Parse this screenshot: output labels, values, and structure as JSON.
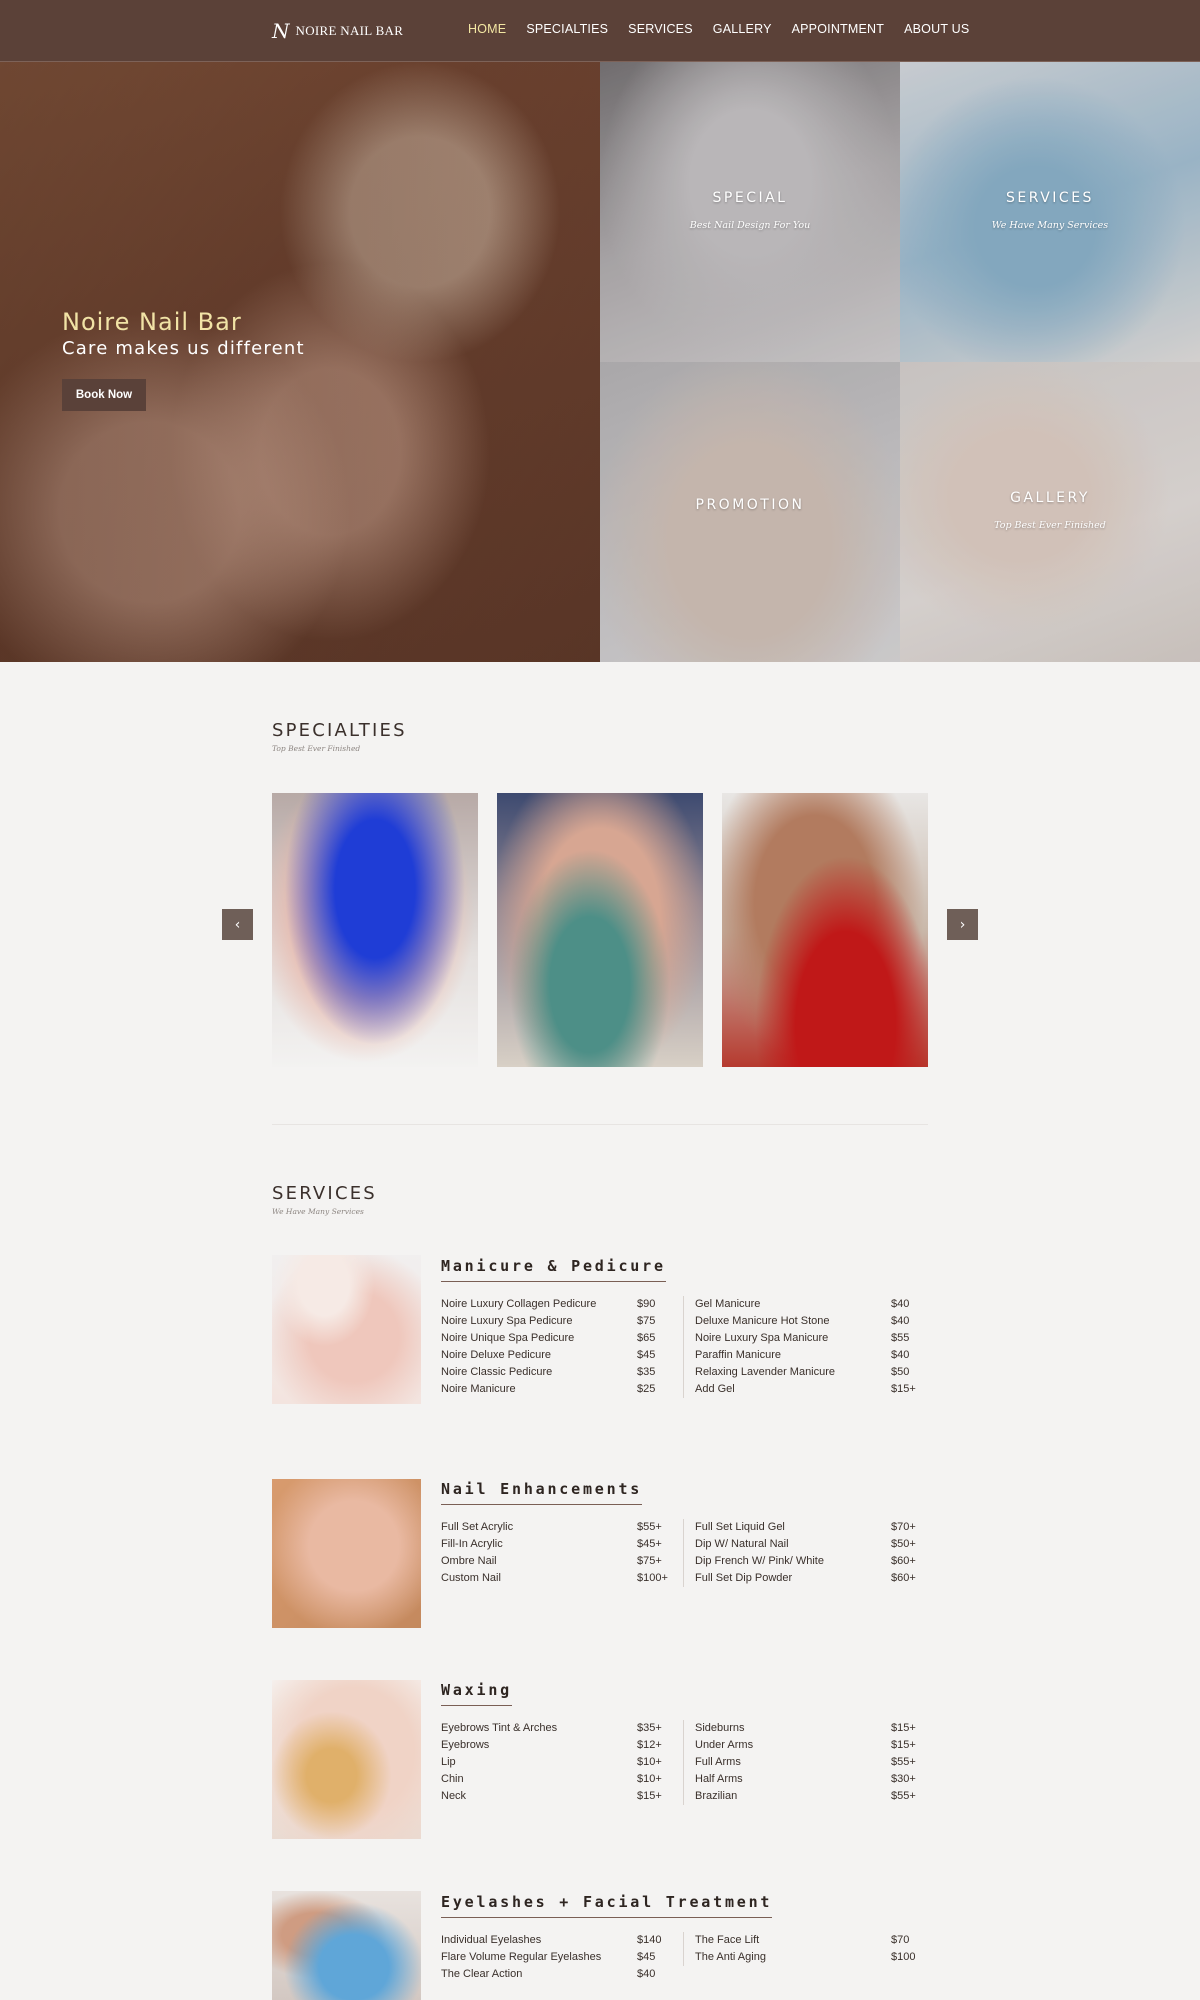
{
  "nav": {
    "logo_mark": "N",
    "logo_text": "NOIRE NAIL BAR",
    "items": [
      "HOME",
      "SPECIALTIES",
      "SERVICES",
      "GALLERY",
      "APPOINTMENT",
      "ABOUT US"
    ]
  },
  "hero": {
    "title": "Noire Nail Bar",
    "subtitle": "Care makes us different",
    "button": "Book Now",
    "tiles": {
      "special": {
        "title": "SPECIAL",
        "subtitle": "Best Nail Design For You"
      },
      "services": {
        "title": "SERVICES",
        "subtitle": "We Have Many Services"
      },
      "promotion": {
        "title": "PROMOTION"
      },
      "gallery": {
        "title": "GALLERY",
        "subtitle": "Top Best Ever Finished"
      }
    }
  },
  "specialties": {
    "title": "SPECIALTIES",
    "subtitle": "Top Best Ever Finished",
    "prev_icon": "‹",
    "next_icon": "›"
  },
  "services": {
    "title": "SERVICES",
    "subtitle": "We Have Many Services",
    "groups": [
      {
        "title": "Manicure & Pedicure",
        "left": [
          {
            "name": "Noire Luxury Collagen Pedicure",
            "price": "$90"
          },
          {
            "name": "Noire Luxury Spa Pedicure",
            "price": "$75"
          },
          {
            "name": "Noire Unique Spa Pedicure",
            "price": "$65"
          },
          {
            "name": "Noire Deluxe Pedicure",
            "price": "$45"
          },
          {
            "name": "Noire Classic Pedicure",
            "price": "$35"
          },
          {
            "name": "Noire Manicure",
            "price": "$25"
          }
        ],
        "right": [
          {
            "name": "Gel Manicure",
            "price": "$40"
          },
          {
            "name": "Deluxe Manicure Hot Stone",
            "price": "$40"
          },
          {
            "name": "Noire Luxury Spa Manicure",
            "price": "$55"
          },
          {
            "name": "Paraffin Manicure",
            "price": "$40"
          },
          {
            "name": "Relaxing Lavender Manicure",
            "price": "$50"
          },
          {
            "name": "Add Gel",
            "price": "$15+"
          }
        ]
      },
      {
        "title": "Nail Enhancements",
        "left": [
          {
            "name": "Full Set Acrylic",
            "price": "$55+"
          },
          {
            "name": "Fill-In Acrylic",
            "price": "$45+"
          },
          {
            "name": "Ombre Nail",
            "price": "$75+"
          },
          {
            "name": "Custom Nail",
            "price": "$100+"
          }
        ],
        "right": [
          {
            "name": "Full Set Liquid Gel",
            "price": "$70+"
          },
          {
            "name": "Dip W/ Natural Nail",
            "price": "$50+"
          },
          {
            "name": "Dip French W/ Pink/ White",
            "price": "$60+"
          },
          {
            "name": "Full Set Dip Powder",
            "price": "$60+"
          }
        ]
      },
      {
        "title": "Waxing",
        "left": [
          {
            "name": "Eyebrows Tint & Arches",
            "price": "$35+"
          },
          {
            "name": "Eyebrows",
            "price": "$12+"
          },
          {
            "name": "Lip",
            "price": "$10+"
          },
          {
            "name": "Chin",
            "price": "$10+"
          },
          {
            "name": "Neck",
            "price": "$15+"
          }
        ],
        "right": [
          {
            "name": "Sideburns",
            "price": "$15+"
          },
          {
            "name": "Under Arms",
            "price": "$15+"
          },
          {
            "name": "Full Arms",
            "price": "$55+"
          },
          {
            "name": "Half Arms",
            "price": "$30+"
          },
          {
            "name": "Brazilian",
            "price": "$55+"
          }
        ]
      },
      {
        "title": "Eyelashes + Facial Treatment",
        "left": [
          {
            "name": "Individual Eyelashes",
            "price": "$140"
          },
          {
            "name": "Flare Volume Regular Eyelashes",
            "price": "$45"
          },
          {
            "name": "The Clear Action",
            "price": "$40"
          }
        ],
        "right": [
          {
            "name": "The Face Lift",
            "price": "$70"
          },
          {
            "name": "The Anti Aging",
            "price": "$100"
          }
        ]
      }
    ]
  }
}
